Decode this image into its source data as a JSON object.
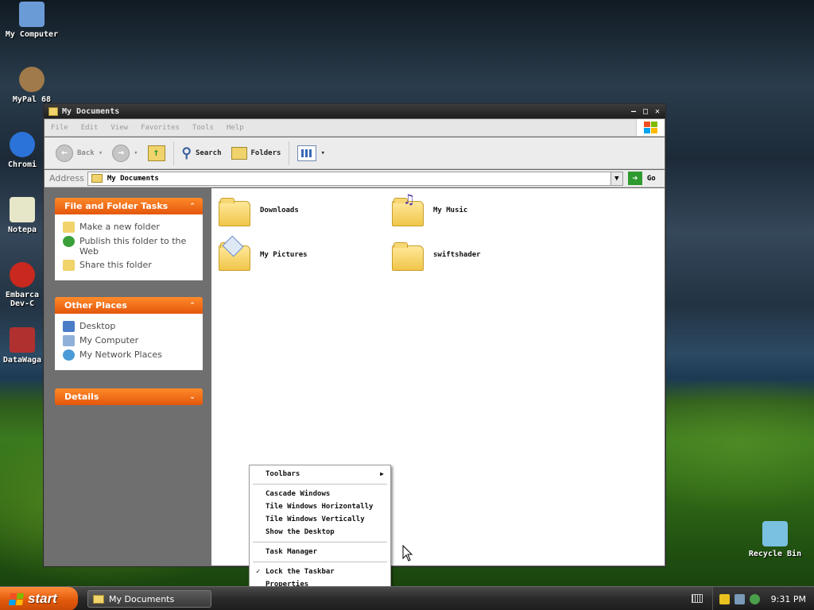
{
  "desktop": {
    "icons": [
      {
        "label": "My Computer",
        "color": "#6b9bd6"
      },
      {
        "label": "MyPal 68",
        "color": "#a07a4a"
      },
      {
        "label": "Chromi",
        "color": "#2b73d8"
      },
      {
        "label": "Notepa",
        "color": "#e6e6c8"
      },
      {
        "label": "Embarca Dev-C",
        "color": "#c8281e"
      },
      {
        "label": "DataWaga",
        "color": "#b03030"
      },
      {
        "label": "Recycle Bin",
        "color": "#7ac0e0"
      }
    ]
  },
  "window": {
    "title": "My Documents",
    "menu": [
      "File",
      "Edit",
      "View",
      "Favorites",
      "Tools",
      "Help"
    ],
    "toolbar": {
      "back": "Back",
      "search": "Search",
      "folders": "Folders"
    },
    "address": {
      "label": "Address",
      "value": "My Documents",
      "go": "Go"
    }
  },
  "tasks": {
    "file_folder": {
      "title": "File and Folder Tasks",
      "items": [
        "Make a new folder",
        "Publish this folder to the Web",
        "Share this folder"
      ]
    },
    "other_places": {
      "title": "Other Places",
      "items": [
        "Desktop",
        "My Computer",
        "My Network Places"
      ]
    },
    "details": {
      "title": "Details"
    }
  },
  "folders": [
    {
      "name": "Downloads"
    },
    {
      "name": "My Music"
    },
    {
      "name": "My Pictures"
    },
    {
      "name": "swiftshader"
    }
  ],
  "context_menu": {
    "items": [
      "Toolbars",
      "Cascade Windows",
      "Tile Windows Horizontally",
      "Tile Windows Vertically",
      "Show the Desktop",
      "Task Manager",
      "Lock the Taskbar",
      "Properties"
    ]
  },
  "taskbar": {
    "start": "start",
    "task": "My Documents",
    "clock": "9:31 PM"
  },
  "colors": {
    "accent": "#e4560b",
    "start_green": "#2f9a2f"
  }
}
